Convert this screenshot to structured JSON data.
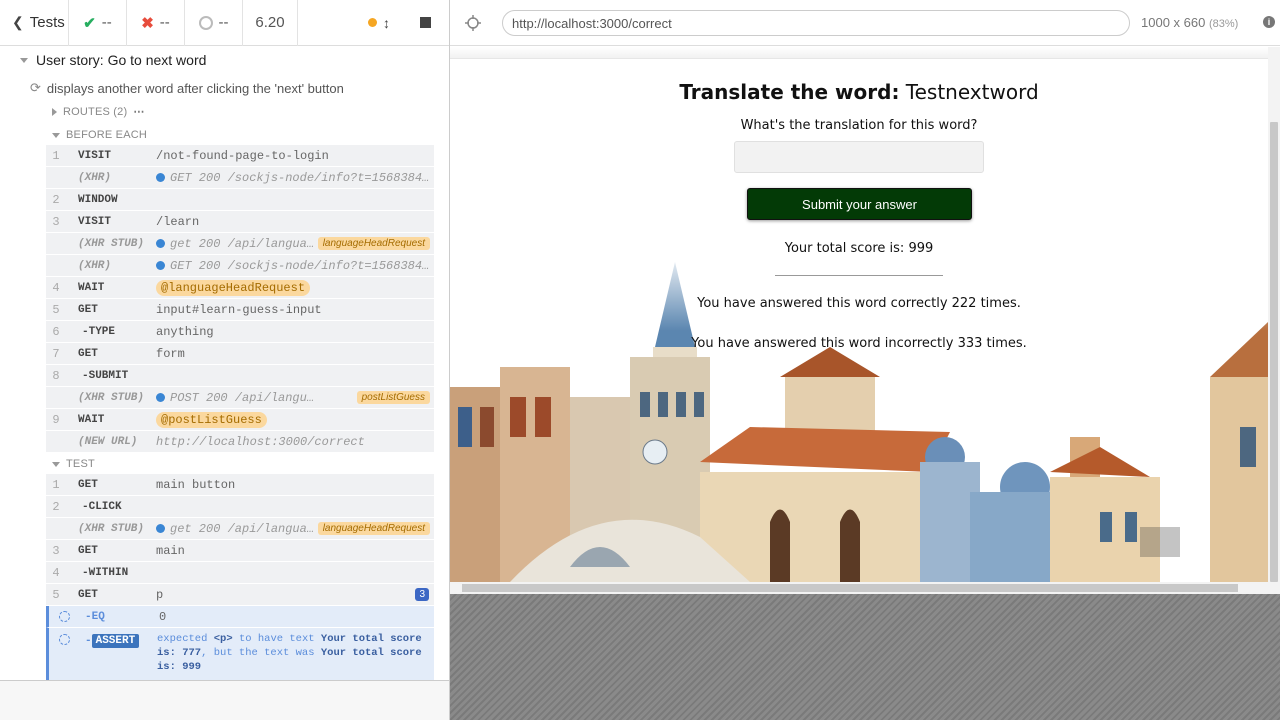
{
  "reporter": {
    "tests_label": "Tests",
    "passed": "--",
    "failed": "--",
    "pending": "--",
    "duration": "6.20",
    "suite_title": "User story: Go to next word",
    "test_title": "displays another word after clicking the 'next' button",
    "routes_label": "ROUTES (2)",
    "before_each_label": "BEFORE EACH",
    "test_label": "TEST",
    "before_each": [
      {
        "num": "1",
        "name": "VISIT",
        "msg": "/not-found-page-to-login"
      },
      {
        "num": "",
        "name": "(XHR)",
        "msg": "GET 200 /sockjs-node/info?t=1568384..."
      },
      {
        "num": "2",
        "name": "WINDOW",
        "msg": ""
      },
      {
        "num": "3",
        "name": "VISIT",
        "msg": "/learn"
      },
      {
        "num": "",
        "name": "(XHR STUB)",
        "msg": "get 200 /api/langua...",
        "tag": "languageHeadRequest"
      },
      {
        "num": "",
        "name": "(XHR)",
        "msg": "GET 200 /sockjs-node/info?t=1568384..."
      },
      {
        "num": "4",
        "name": "WAIT",
        "msg": "@languageHeadRequest"
      },
      {
        "num": "5",
        "name": "GET",
        "msg": "input#learn-guess-input"
      },
      {
        "num": "6",
        "name": "-TYPE",
        "msg": "anything"
      },
      {
        "num": "7",
        "name": "GET",
        "msg": "form"
      },
      {
        "num": "8",
        "name": "-SUBMIT",
        "msg": ""
      },
      {
        "num": "",
        "name": "(XHR STUB)",
        "msg": "POST 200 /api/language/g...",
        "tag": "postListGuess"
      },
      {
        "num": "9",
        "name": "WAIT",
        "msg": "@postListGuess"
      },
      {
        "num": "",
        "name": "(NEW URL)",
        "msg": "http://localhost:3000/correct"
      }
    ],
    "test": [
      {
        "num": "1",
        "name": "GET",
        "msg": "main button"
      },
      {
        "num": "2",
        "name": "-CLICK",
        "msg": ""
      },
      {
        "num": "",
        "name": "(XHR STUB)",
        "msg": "get 200 /api/langua...",
        "tag": "languageHeadRequest"
      },
      {
        "num": "3",
        "name": "GET",
        "msg": "main"
      },
      {
        "num": "4",
        "name": "-WITHIN",
        "msg": ""
      },
      {
        "num": "5",
        "name": "GET",
        "msg": "p",
        "badge": "3"
      },
      {
        "num": "",
        "name": "-EQ",
        "msg": "0"
      },
      {
        "num": "",
        "name": "-ASSERT",
        "msg": ""
      }
    ],
    "assert_parts": {
      "a": "expected",
      "b": "<p>",
      "c": "to have text",
      "d": "Your total score is: 777",
      "e": ", but the text was",
      "f": "Your total score is: 999"
    }
  },
  "aut": {
    "url": "http://localhost:3000/correct",
    "size": "1000 x 660",
    "scale": "(83%)"
  },
  "app": {
    "heading_label": "Translate the word:",
    "heading_word": "Testnextword",
    "question": "What's the translation for this word?",
    "submit_label": "Submit your answer",
    "score_text": "Your total score is: 999",
    "correct_text": "You have answered this word correctly 222 times.",
    "incorrect_text": "You have answered this word incorrectly 333 times."
  },
  "colors": {
    "submit_bg": "#033a06",
    "alias_bg": "#fbd89e",
    "xhr_dot": "#3a86d4",
    "badge": "#3c67c4"
  }
}
